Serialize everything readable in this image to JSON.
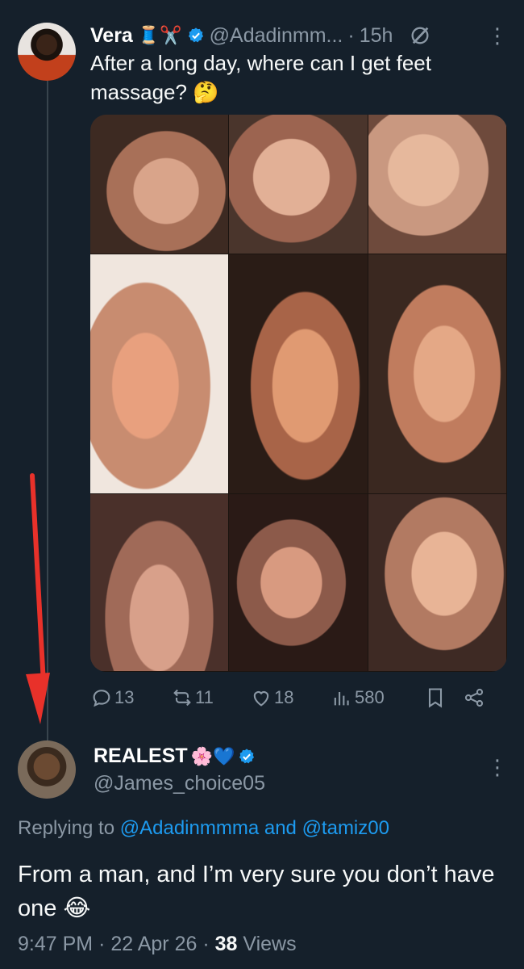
{
  "tweet": {
    "author_name": "Vera",
    "author_emojis": "🧵✂️",
    "handle": "@Adadinmm...",
    "separator": "·",
    "time": "15h",
    "text": "After a long day, where can I get feet massage? 🤔",
    "stats": {
      "replies": "13",
      "reposts": "11",
      "likes": "18",
      "views": "580"
    }
  },
  "reply": {
    "author_name": "REALEST",
    "author_emojis": "🌸💙",
    "handle": "@James_choice05",
    "replying_prefix": "Replying to",
    "replying_user1": "@Adadinmmma",
    "replying_and": "and",
    "replying_user2": "@tamiz00",
    "text": "From a man, and I’m very sure you don’t have one  😂",
    "time": "9:47 PM",
    "date": "22 Apr 26",
    "sep": "·",
    "views_count": "38",
    "views_label": "Views"
  },
  "colors": {
    "background": "#15202b",
    "accent": "#1d9bf0",
    "muted": "#8b98a5",
    "annotation": "#e8312a"
  },
  "icons": [
    "verified-icon",
    "grok-icon",
    "more-icon",
    "reply-icon",
    "repost-icon",
    "like-icon",
    "views-icon",
    "bookmark-icon",
    "share-icon",
    "annotation-arrow"
  ]
}
